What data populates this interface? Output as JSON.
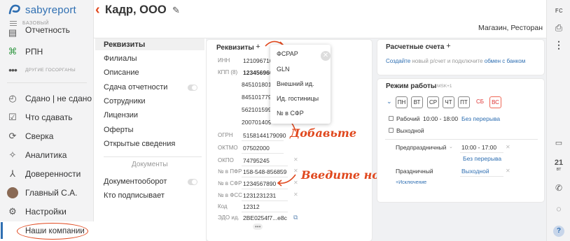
{
  "app": {
    "logo_text_a": "saby",
    "logo_text_b": "report",
    "brand_color": "#2f6fb2",
    "accent_color": "#e0481e"
  },
  "sidebar": {
    "base_label": "БАЗОВЫЙ",
    "items": [
      {
        "label": "Отчетность",
        "icon": "report-icon"
      },
      {
        "label": "РПН",
        "icon": "rpn-icon"
      },
      {
        "label": "Сдано | не сдано",
        "icon": "check-circle-icon"
      },
      {
        "label": "Что сдавать",
        "icon": "checklist-icon"
      },
      {
        "label": "Сверка",
        "icon": "compare-icon"
      },
      {
        "label": "Аналитика",
        "icon": "analytics-icon"
      },
      {
        "label": "Доверенности",
        "icon": "trust-icon"
      },
      {
        "label": "Главный С.А.",
        "icon": "avatar"
      },
      {
        "label": "Настройки",
        "icon": "gear-icon"
      },
      {
        "label": "Наши компании",
        "icon": ""
      }
    ],
    "other_label": "ДРУГИЕ ГОСОРГАНЫ"
  },
  "header": {
    "title": "Кадр, ООО",
    "subtitle": "Магазин, Ресторан"
  },
  "rail": {
    "calendar_day": "21",
    "calendar_weekday": "вт"
  },
  "sections": {
    "items": [
      "Реквизиты",
      "Филиалы",
      "Описание",
      "Сдача отчетности",
      "Сотрудники",
      "Лицензии",
      "Оферты",
      "Открытые сведения"
    ],
    "group_label": "Документы",
    "group_items": [
      "Документооборот",
      "Кто подписывает"
    ]
  },
  "requisites": {
    "title": "Реквизиты",
    "rows": [
      {
        "label": "ИНН",
        "value": "121096710"
      },
      {
        "label": "КПП (8)",
        "value": "123456960"
      },
      {
        "label": "",
        "value": "845101801"
      },
      {
        "label": "",
        "value": "845101779"
      },
      {
        "label": "",
        "value": "562101599"
      },
      {
        "label": "",
        "value": "200701409"
      },
      {
        "label": "ОГРН",
        "value": "5158144179090"
      },
      {
        "label": "ОКТМО",
        "value": "07502000"
      },
      {
        "label": "ОКПО",
        "value": "74795245"
      },
      {
        "label": "№ в ПФР",
        "value": "158-548-856859"
      },
      {
        "label": "№ в СФР",
        "value": "1234567890"
      },
      {
        "label": "№ в ФСС",
        "value": "1231231231"
      },
      {
        "label": "Код",
        "value": "12312"
      },
      {
        "label": "ЭДО ид.",
        "value": "2BE0254f7...e8c"
      }
    ],
    "more": "•••"
  },
  "dropdown": {
    "items": [
      "ФСРАР",
      "GLN",
      "Внешний ид.",
      "Ид. гостиницы",
      "№ в СФР"
    ]
  },
  "hints": {
    "add": "Добавьте",
    "enter": "Введите номер"
  },
  "accounts": {
    "title": "Расчетные счета",
    "create": "Создайте",
    "middle": " новый р/счет и подключите ",
    "link": "обмен с банком"
  },
  "work_mode": {
    "title": "Режим работы",
    "tz": "MSK+1",
    "days": [
      "ПН",
      "ВТ",
      "СР",
      "ЧТ",
      "ПТ",
      "СБ",
      "ВС"
    ],
    "workday_label": "Рабочий",
    "workday_time": "10:00 - 18:00",
    "no_break": "Без перерыва",
    "weekend_label": "Выходной",
    "preholiday_label": "Предпраздничный",
    "preholiday_time": "10:00 - 17:00",
    "preholiday_break": "Без перерыва",
    "holiday_label": "Праздничный",
    "holiday_value": "Выходной",
    "exception": "+Исключение"
  }
}
